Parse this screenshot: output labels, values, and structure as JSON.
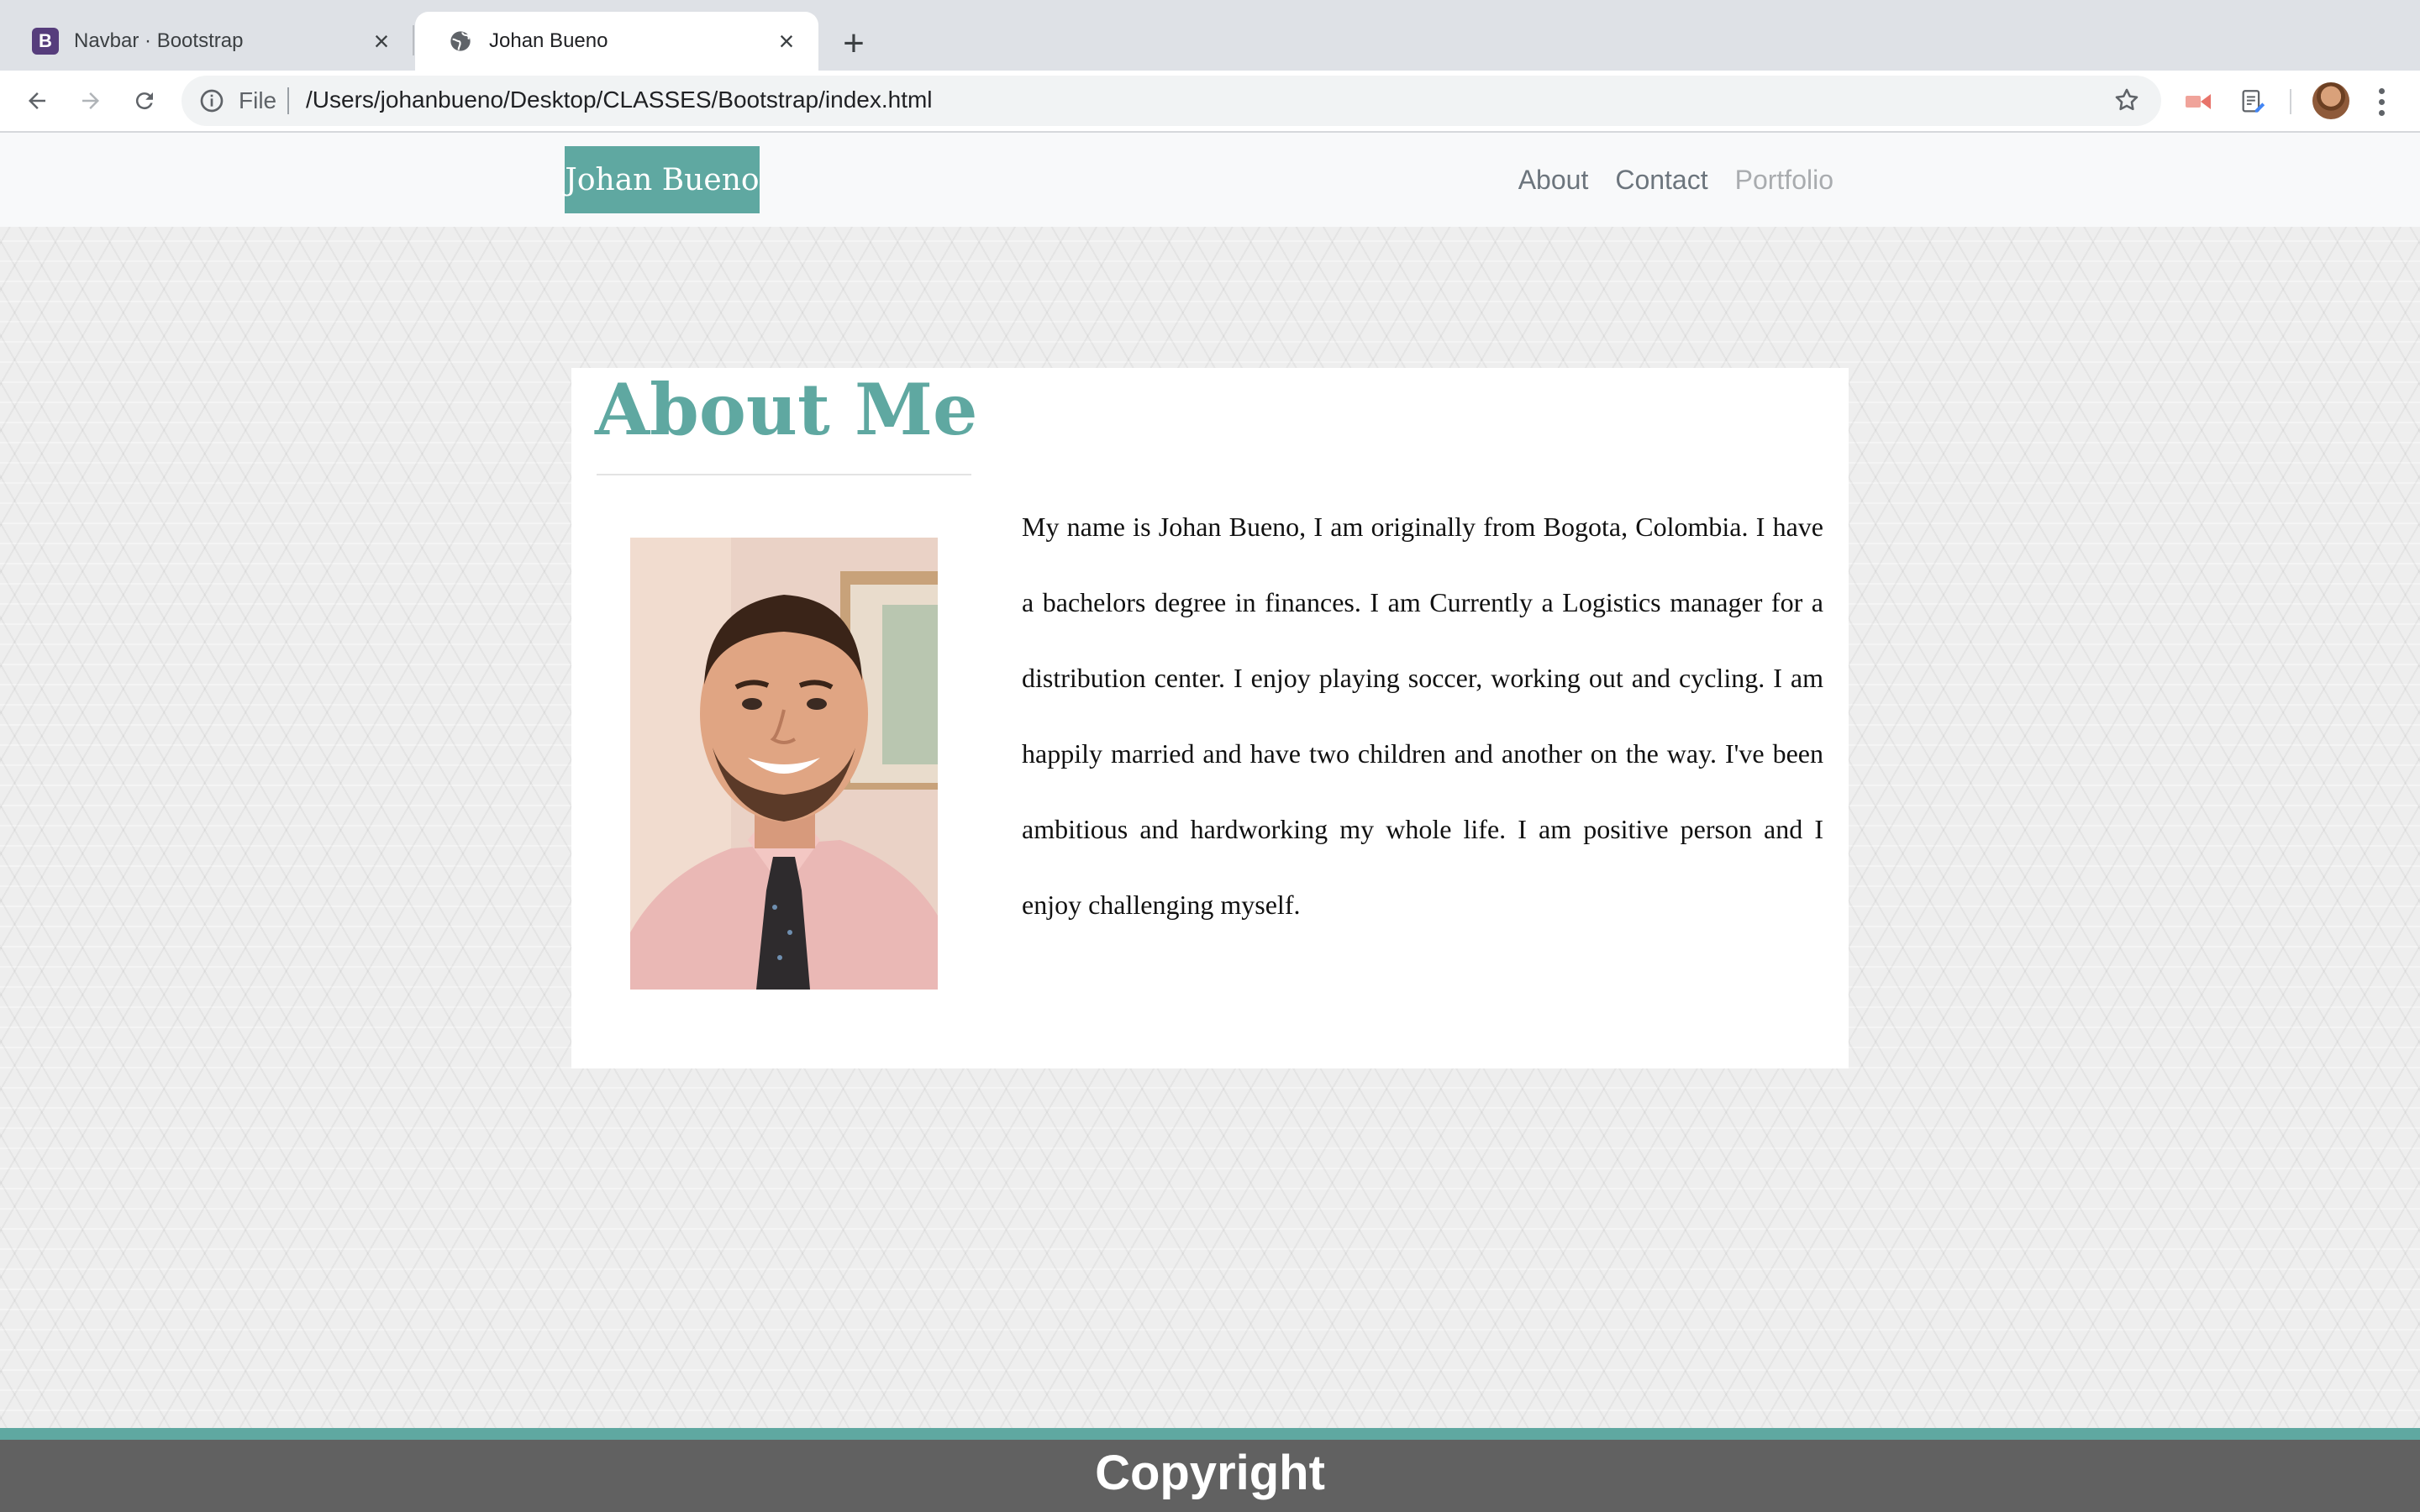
{
  "browser": {
    "tabs": [
      {
        "title": "Navbar · Bootstrap",
        "favicon_letter": "B",
        "active": false
      },
      {
        "title": "Johan Bueno",
        "active": true
      }
    ],
    "close_glyph": "×",
    "new_tab_glyph": "+",
    "omnibox": {
      "scheme_label": "File",
      "url": "/Users/johanbueno/Desktop/CLASSES/Bootstrap/index.html"
    }
  },
  "site": {
    "brand": "Johan Bueno",
    "nav": [
      {
        "label": "About"
      },
      {
        "label": "Contact"
      },
      {
        "label": "Portfolio"
      }
    ]
  },
  "about": {
    "heading": "About Me",
    "bio": "My name is Johan Bueno, I am originally from Bogota, Colombia. I have a bachelors degree in finances. I am Currently a Logistics manager for a distribution center. I enjoy playing soccer, working out and cycling. I am happily married and have two children and another on the way. I've been ambitious and hardworking my whole life. I am positive person and I enjoy challenging myself."
  },
  "footer": {
    "text": "Copyright"
  },
  "colors": {
    "accent": "#5fa8a1",
    "footer_bg": "#616161",
    "navbar_bg": "#f8f9fa"
  }
}
